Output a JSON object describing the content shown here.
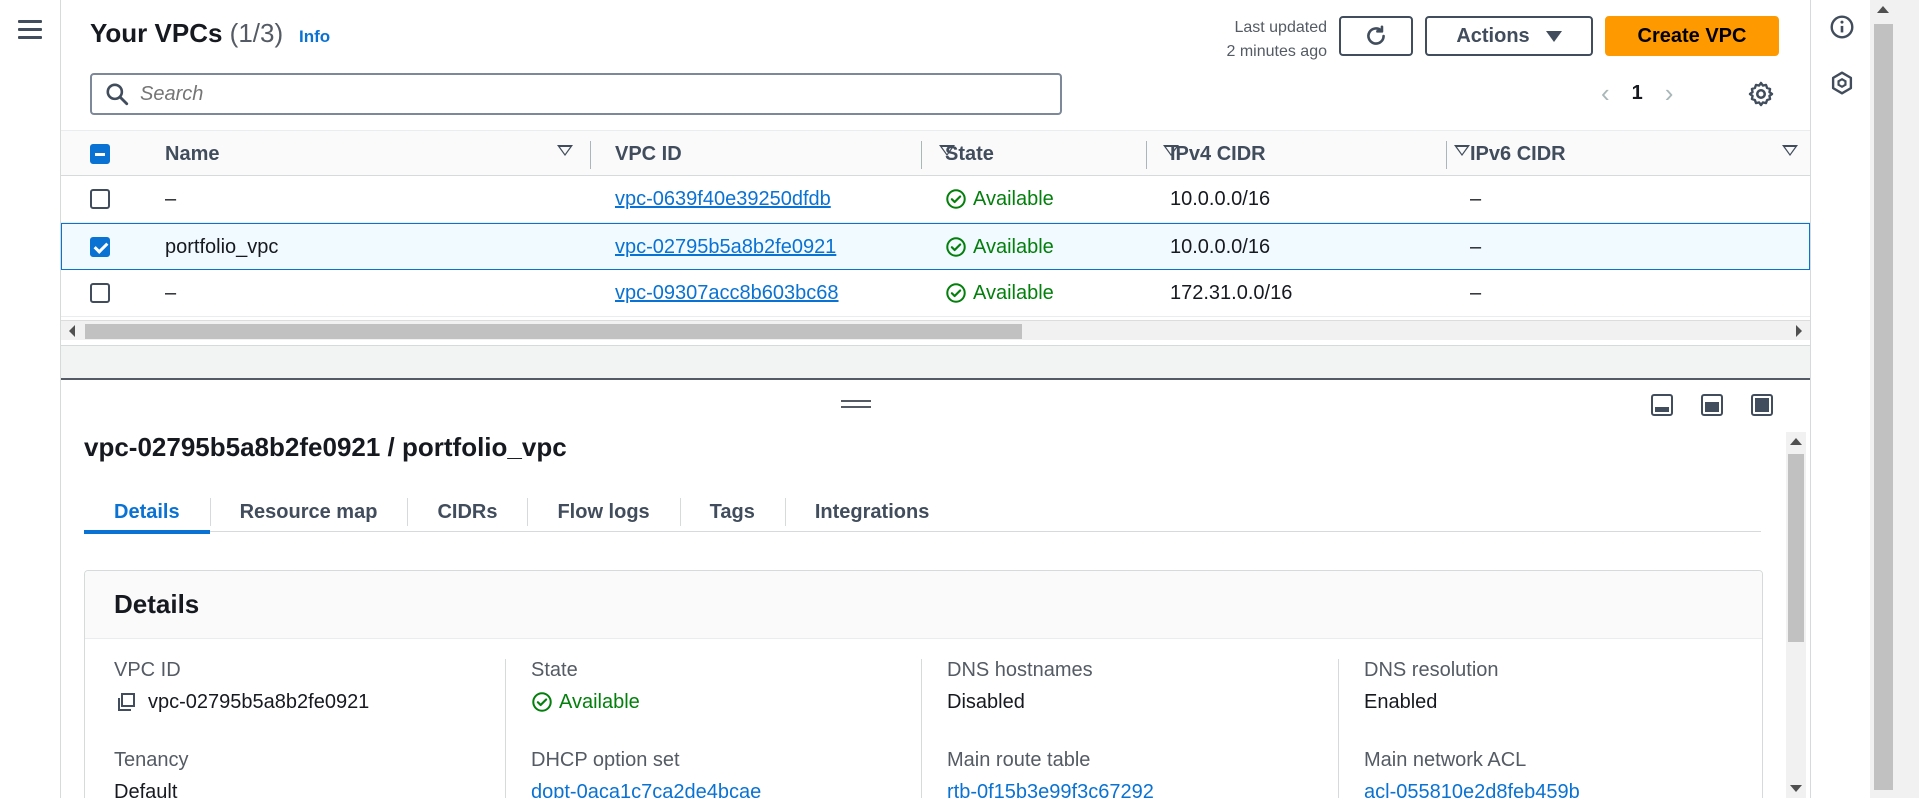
{
  "header": {
    "title": "Your VPCs",
    "count": "(1/3)",
    "info": "Info",
    "last_updated_line1": "Last updated",
    "last_updated_line2": "2 minutes ago",
    "actions_label": "Actions",
    "create_label": "Create VPC"
  },
  "search": {
    "placeholder": "Search"
  },
  "pagination": {
    "page": "1",
    "prev": "‹",
    "next": "›"
  },
  "table": {
    "columns": [
      "Name",
      "VPC ID",
      "State",
      "IPv4 CIDR",
      "IPv6 CIDR"
    ],
    "rows": [
      {
        "name": "–",
        "vpc_id": "vpc-0639f40e39250dfdb",
        "state": "Available",
        "ipv4": "10.0.0.0/16",
        "ipv6": "–",
        "selected": false
      },
      {
        "name": "portfolio_vpc",
        "vpc_id": "vpc-02795b5a8b2fe0921",
        "state": "Available",
        "ipv4": "10.0.0.0/16",
        "ipv6": "–",
        "selected": true
      },
      {
        "name": "–",
        "vpc_id": "vpc-09307acc8b603bc68",
        "state": "Available",
        "ipv4": "172.31.0.0/16",
        "ipv6": "–",
        "selected": false
      }
    ]
  },
  "detail": {
    "title": "vpc-02795b5a8b2fe0921 / portfolio_vpc",
    "tabs": [
      "Details",
      "Resource map",
      "CIDRs",
      "Flow logs",
      "Tags",
      "Integrations"
    ],
    "active_tab": "Details",
    "card_title": "Details",
    "fields": {
      "vpc_id_label": "VPC ID",
      "vpc_id_value": "vpc-02795b5a8b2fe0921",
      "state_label": "State",
      "state_value": "Available",
      "dns_hostnames_label": "DNS hostnames",
      "dns_hostnames_value": "Disabled",
      "dns_resolution_label": "DNS resolution",
      "dns_resolution_value": "Enabled",
      "tenancy_label": "Tenancy",
      "tenancy_value": "Default",
      "dhcp_label": "DHCP option set",
      "dhcp_value": "dopt-0aca1c7ca2de4bcae",
      "main_route_label": "Main route table",
      "main_route_value": "rtb-0f15b3e99f3c67292",
      "main_acl_label": "Main network ACL",
      "main_acl_value": "acl-055810e2d8feb459b"
    }
  },
  "colors": {
    "accent": "#0972d3",
    "primary_button": "#ff9900",
    "success": "#037f0c",
    "text": "#16191f"
  },
  "icons": [
    "menu-icon",
    "search-icon",
    "refresh-icon",
    "caret-down-icon",
    "settings-gear-icon",
    "info-circle-icon",
    "hexagon-icon",
    "check-circle-icon",
    "copy-icon",
    "drag-handle-icon"
  ]
}
